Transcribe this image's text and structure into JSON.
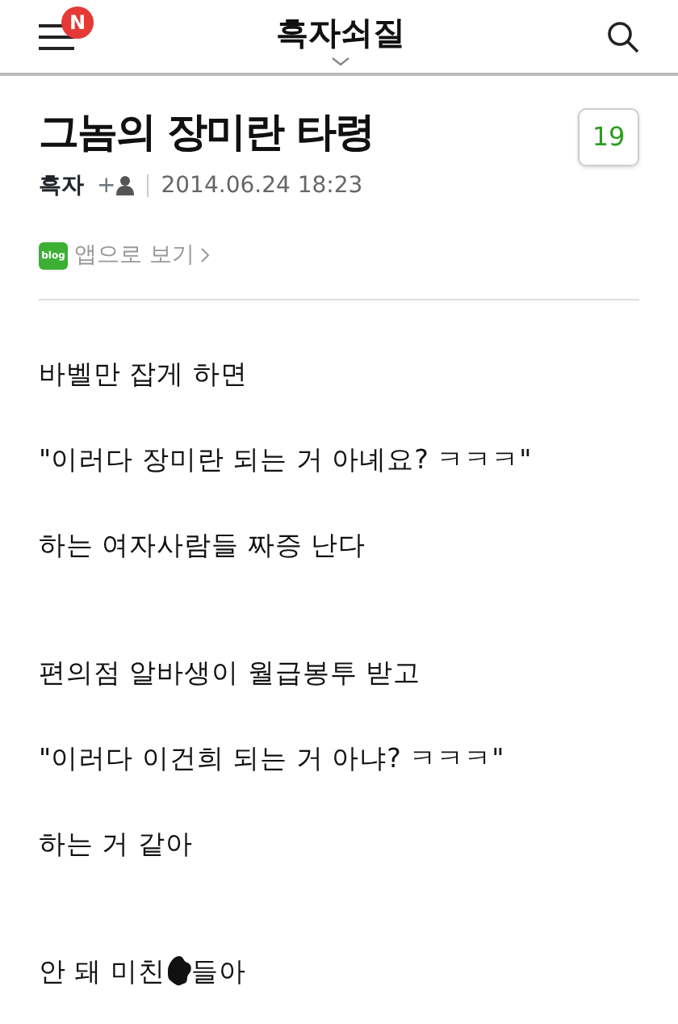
{
  "header": {
    "title": "흑자쇠질",
    "badge": "N"
  },
  "post": {
    "title": "그놈의 장미란 타령",
    "comment_count": "19",
    "author": "흑자",
    "follow": "+",
    "date": "2014.06.24 18:23",
    "app_link": "앱으로 보기",
    "app_icon_label": "blog"
  },
  "body": [
    {
      "kind": "text",
      "text": "바벨만 잡게 하면"
    },
    {
      "kind": "text",
      "text": "\"이러다 장미란 되는 거 아녜요? ㅋㅋㅋ\""
    },
    {
      "kind": "text",
      "text": "하는 여자사람들 짜증 난다"
    },
    {
      "kind": "blank"
    },
    {
      "kind": "text",
      "text": "편의점 알바생이 월급봉투 받고"
    },
    {
      "kind": "text",
      "text": "\"이러다 이건희 되는 거 아냐? ㅋㅋㅋ\""
    },
    {
      "kind": "text",
      "text": "하는 거 같아"
    },
    {
      "kind": "blank"
    },
    {
      "kind": "blotted",
      "before": "안 돼 미친",
      "after": "들아"
    }
  ]
}
